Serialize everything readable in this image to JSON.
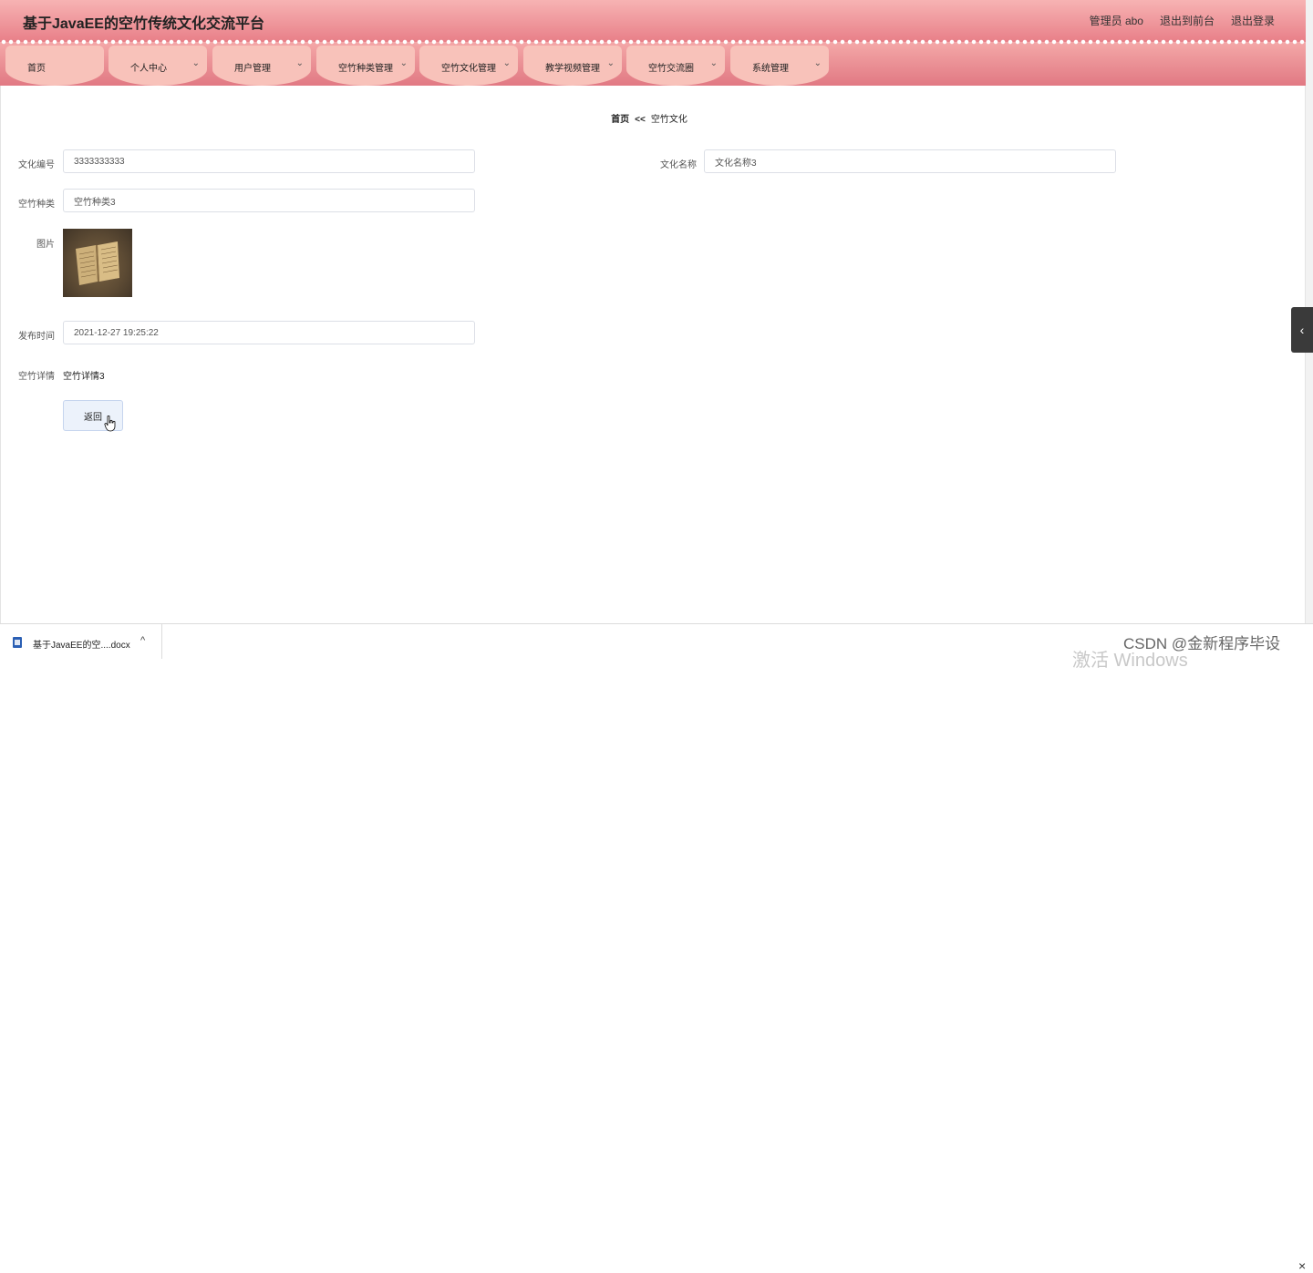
{
  "header": {
    "title": "基于JavaEE的空竹传统文化交流平台",
    "admin": "管理员 abo",
    "to_front": "退出到前台",
    "logout": "退出登录"
  },
  "nav": {
    "items": [
      {
        "label": "首页",
        "has_dropdown": false
      },
      {
        "label": "个人中心",
        "has_dropdown": true
      },
      {
        "label": "用户管理",
        "has_dropdown": true
      },
      {
        "label": "空竹种类管理",
        "has_dropdown": true
      },
      {
        "label": "空竹文化管理",
        "has_dropdown": true
      },
      {
        "label": "教学视频管理",
        "has_dropdown": true
      },
      {
        "label": "空竹交流圈",
        "has_dropdown": true
      },
      {
        "label": "系统管理",
        "has_dropdown": true
      }
    ]
  },
  "breadcrumb": {
    "home": "首页",
    "separator": "<<",
    "current": "空竹文化"
  },
  "form": {
    "culture_no_label": "文化编号",
    "culture_no_value": "3333333333",
    "culture_name_label": "文化名称",
    "culture_name_value": "文化名称3",
    "category_label": "空竹种类",
    "category_value": "空竹种类3",
    "image_label": "图片",
    "publish_time_label": "发布时间",
    "publish_time_value": "2021-12-27 19:25:22",
    "detail_label": "空竹详情",
    "detail_value": "空竹详情3",
    "back_button": "返回"
  },
  "download_bar": {
    "file_name": "基于JavaEE的空....docx"
  },
  "overlay": {
    "watermark": "CSDN @金新程序毕设",
    "activate_windows": "激活 Windows"
  },
  "colors": {
    "header_top": "#f7b3b3",
    "header_bottom": "#e87f88",
    "nav_tab": "#f8c2ba",
    "button_bg": "#ecf2fb"
  }
}
